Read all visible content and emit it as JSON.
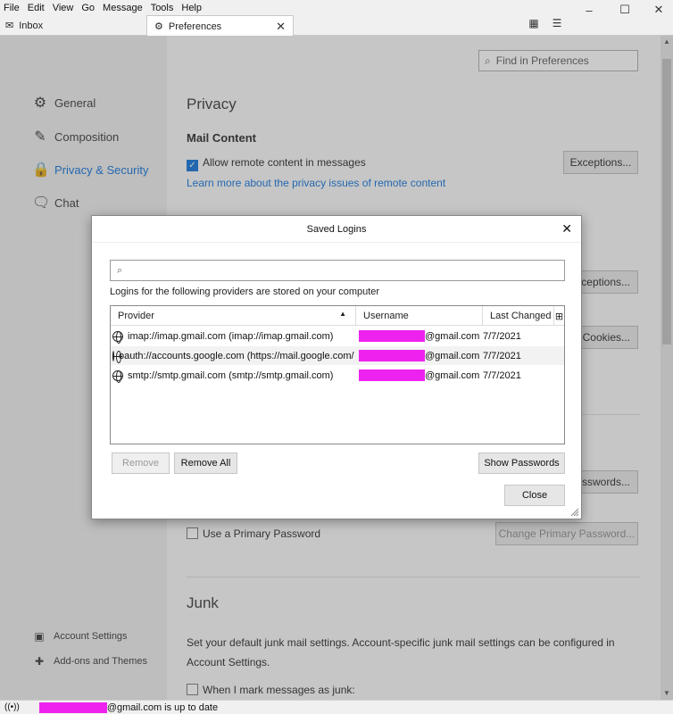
{
  "menubar": {
    "items": [
      {
        "label": "File"
      },
      {
        "label": "Edit"
      },
      {
        "label": "View"
      },
      {
        "label": "Go"
      },
      {
        "label": "Message"
      },
      {
        "label": "Tools"
      },
      {
        "label": "Help"
      }
    ]
  },
  "window_controls": {
    "minimize": "–",
    "maximize": "☐",
    "close": "✕"
  },
  "tabs": [
    {
      "label": "Inbox",
      "icon": "envelope-icon"
    },
    {
      "label": "Preferences",
      "icon": "gear-icon",
      "close": "✕"
    }
  ],
  "sidebar": {
    "items": [
      {
        "label": "General",
        "icon": "gear-icon"
      },
      {
        "label": "Composition",
        "icon": "pencil-icon"
      },
      {
        "label": "Privacy & Security",
        "icon": "lock-icon"
      },
      {
        "label": "Chat",
        "icon": "chat-icon"
      }
    ],
    "footer": [
      {
        "label": "Account Settings",
        "icon": "account-icon"
      },
      {
        "label": "Add-ons and Themes",
        "icon": "puzzle-icon"
      }
    ]
  },
  "search": {
    "placeholder": "Find in Preferences"
  },
  "content": {
    "privacy_heading": "Privacy",
    "mail_content_heading": "Mail Content",
    "allow_remote": "Allow remote content in messages",
    "exceptions_1": "Exceptions...",
    "learn_more": "Learn more about the privacy issues of remote content",
    "exceptions_2": "Exceptions...",
    "cookies": "Cookies...",
    "passwords": "Passwords...",
    "primary_password": "Use a Primary Password",
    "change_primary": "Change Primary Password...",
    "junk_heading": "Junk",
    "junk_text_1": "Set your default junk mail settings. Account-specific junk mail settings can be configured in",
    "junk_text_2": "Account Settings.",
    "when_junk": "When I mark messages as junk:"
  },
  "dialog": {
    "title": "Saved Logins",
    "close": "✕",
    "note": "Logins for the following providers are stored on your computer",
    "columns": {
      "provider": "Provider",
      "username": "Username",
      "last_changed": "Last Changed"
    },
    "rows": [
      {
        "provider": "imap://imap.gmail.com (imap://imap.gmail.com)",
        "username_suffix": "@gmail.com",
        "date": "7/7/2021"
      },
      {
        "provider": "oauth://accounts.google.com (https://mail.google.com/)",
        "username_suffix": "@gmail.com",
        "date": "7/7/2021"
      },
      {
        "provider": "smtp://smtp.gmail.com (smtp://smtp.gmail.com)",
        "username_suffix": "@gmail.com",
        "date": "7/7/2021"
      }
    ],
    "remove": "Remove",
    "remove_all": "Remove All",
    "show_passwords": "Show Passwords",
    "close_button": "Close"
  },
  "status": {
    "text": "@gmail.com is up to date"
  },
  "colors": {
    "accent": "#0a6fd8",
    "redaction": "#ee22ee"
  }
}
